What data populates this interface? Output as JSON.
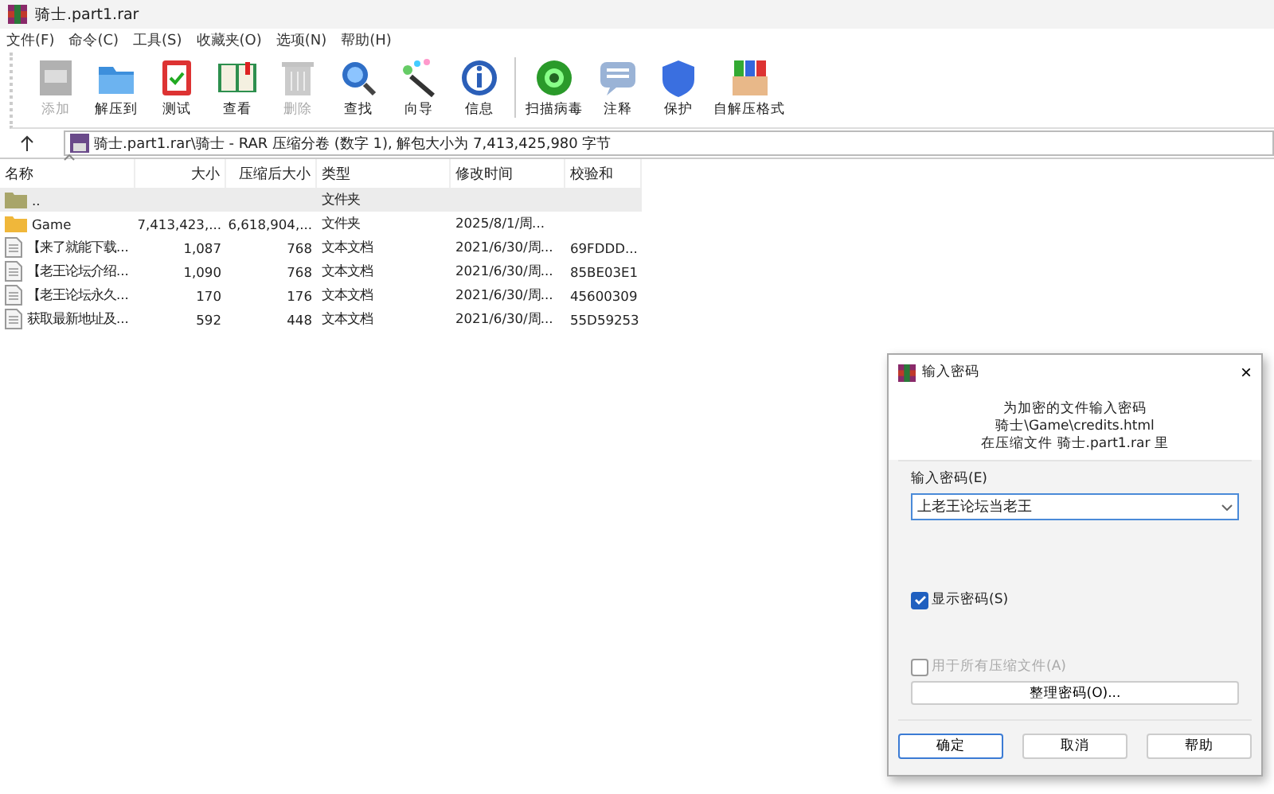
{
  "window": {
    "title": "骑士.part1.rar"
  },
  "menu": [
    "文件(F)",
    "命令(C)",
    "工具(S)",
    "收藏夹(O)",
    "选项(N)",
    "帮助(H)"
  ],
  "toolbar": [
    {
      "label": "添加",
      "disabled": true
    },
    {
      "label": "解压到",
      "disabled": false
    },
    {
      "label": "测试",
      "disabled": false
    },
    {
      "label": "查看",
      "disabled": false
    },
    {
      "label": "删除",
      "disabled": true
    },
    {
      "label": "查找",
      "disabled": false
    },
    {
      "label": "向导",
      "disabled": false
    },
    {
      "label": "信息",
      "disabled": false
    },
    {
      "label": "扫描病毒",
      "disabled": false
    },
    {
      "label": "注释",
      "disabled": false
    },
    {
      "label": "保护",
      "disabled": false
    },
    {
      "label": "自解压格式",
      "disabled": false
    }
  ],
  "address": {
    "text": "骑士.part1.rar\\骑士 - RAR 压缩分卷 (数字 1), 解包大小为 7,413,425,980 字节"
  },
  "table": {
    "columns": [
      "名称",
      "大小",
      "压缩后大小",
      "类型",
      "修改时间",
      "校验和"
    ],
    "rows": [
      {
        "kind": "parent",
        "selected": true,
        "cells": [
          "..",
          "",
          "",
          "文件夹",
          "",
          ""
        ]
      },
      {
        "kind": "folder",
        "selected": false,
        "cells": [
          "Game",
          "7,413,423,...",
          "6,618,904,...",
          "文件夹",
          "2025/8/1/周...",
          ""
        ]
      },
      {
        "kind": "file",
        "selected": false,
        "cells": [
          "【来了就能下载...",
          "1,087",
          "768",
          "文本文档",
          "2021/6/30/周...",
          "69FDDD..."
        ]
      },
      {
        "kind": "file",
        "selected": false,
        "cells": [
          "【老王论坛介绍...",
          "1,090",
          "768",
          "文本文档",
          "2021/6/30/周...",
          "85BE03E1"
        ]
      },
      {
        "kind": "file",
        "selected": false,
        "cells": [
          "【老王论坛永久...",
          "170",
          "176",
          "文本文档",
          "2021/6/30/周...",
          "45600309"
        ]
      },
      {
        "kind": "file",
        "selected": false,
        "cells": [
          "获取最新地址及...",
          "592",
          "448",
          "文本文档",
          "2021/6/30/周...",
          "55D59253"
        ]
      }
    ]
  },
  "dialog": {
    "title": "输入密码",
    "close": "×",
    "info": [
      "为加密的文件输入密码",
      "骑士\\Game\\credits.html",
      "在压缩文件 骑士.part1.rar 里"
    ],
    "password_label": "输入密码(E)",
    "password": {
      "value": "上老王论坛当老王"
    },
    "checkboxes": [
      {
        "label": "显示密码(S)",
        "checked": true,
        "disabled": false
      },
      {
        "label": "用于所有压缩文件(A)",
        "checked": false,
        "disabled": true
      }
    ],
    "organize_button": "整理密码(O)...",
    "buttons": [
      {
        "label": "确定",
        "selected": true
      },
      {
        "label": "取消",
        "selected": false
      },
      {
        "label": "帮助",
        "selected": false
      }
    ]
  }
}
